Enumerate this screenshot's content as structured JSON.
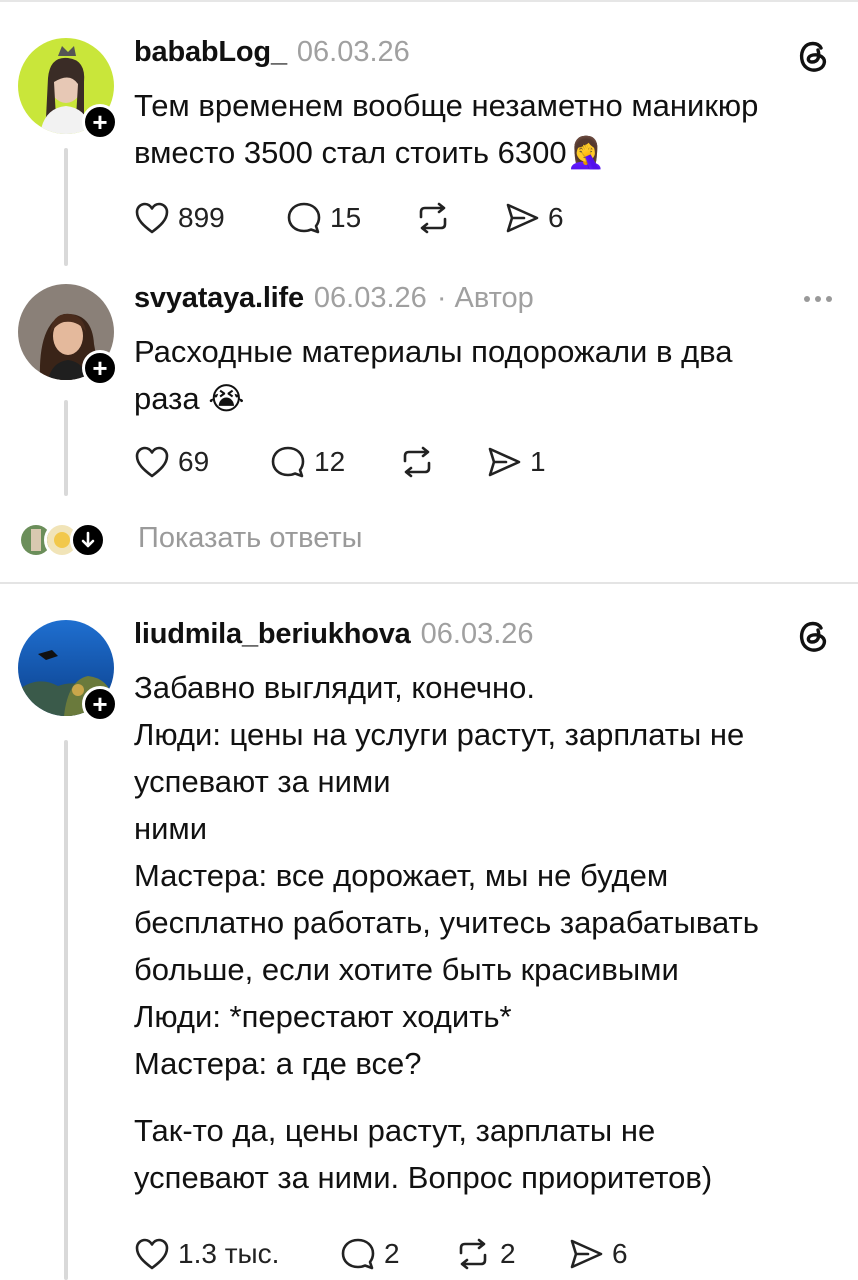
{
  "posts": [
    {
      "username": "bababLog_",
      "date": "06.03.26",
      "text_lines": [
        "Тем временем вообще незаметно маникюр",
        "вместо 3500 стал стоить 6300🤦‍♀️"
      ],
      "likes": "899",
      "comments": "15",
      "reposts": "",
      "shares": "6"
    },
    {
      "username": "svyataya.life",
      "date": "06.03.26",
      "separator": "·",
      "author_label": "Автор",
      "text_lines": [
        "Расходные материалы подорожали в два",
        "раза 😭"
      ],
      "likes": "69",
      "comments": "12",
      "reposts": "",
      "shares": "1"
    },
    {
      "username": "liudmila_beriukhova",
      "date": "06.03.26",
      "text_lines": [
        "Забавно выглядит, конечно.",
        "Люди: цены на услуги растут, зарплаты не",
        "успевают за ними",
        "ними",
        "Мастера: все дорожает, мы не будем",
        "бесплатно работать, учитесь зарабатывать",
        "больше, если хотите быть красивыми",
        "Люди: *перестают ходить*",
        "Мастера: а где все?"
      ],
      "text_lines_2": [
        "Так-то да, цены растут, зарплаты не",
        "успевают за ними. Вопрос приоритетов)"
      ],
      "likes": "1.3 тыс.",
      "comments": "2",
      "reposts": "2",
      "shares": "6"
    }
  ],
  "show_replies": "Показать ответы",
  "icons": {
    "heart": "heart-icon",
    "comment": "comment-icon",
    "repost": "repost-icon",
    "share": "share-icon",
    "threads": "threads-logo-icon",
    "more": "more-icon",
    "follow": "plus-icon",
    "expand": "arrow-down-icon"
  },
  "colors": {
    "text": "#111111",
    "muted": "#a0a0a0",
    "thread_line": "#d9d9d9",
    "badge": "#000000"
  }
}
